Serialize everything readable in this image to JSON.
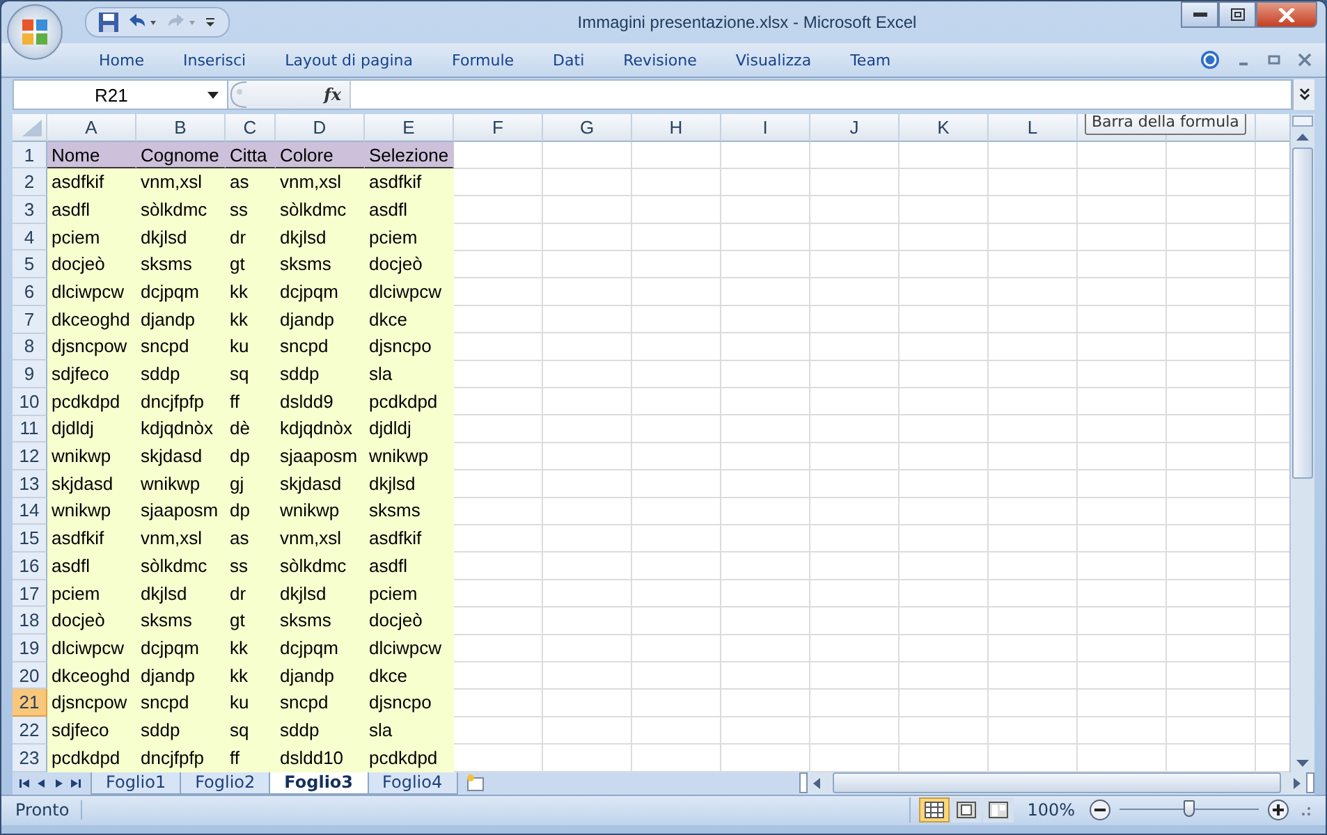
{
  "window": {
    "title": "Immagini presentazione.xlsx - Microsoft Excel"
  },
  "ribbon_tabs": [
    {
      "label": "Home"
    },
    {
      "label": "Inserisci"
    },
    {
      "label": "Layout di pagina"
    },
    {
      "label": "Formule"
    },
    {
      "label": "Dati"
    },
    {
      "label": "Revisione"
    },
    {
      "label": "Visualizza"
    },
    {
      "label": "Team"
    }
  ],
  "name_box": {
    "value": "R21"
  },
  "formula_bar": {
    "fx": "fx",
    "tooltip": "Barra della formula"
  },
  "column_headers": [
    "A",
    "B",
    "C",
    "D",
    "E",
    "F",
    "G",
    "H",
    "I",
    "J",
    "K",
    "L"
  ],
  "rows": [
    {
      "number": "1",
      "kind": "header",
      "selected": false,
      "cells": [
        "Nome",
        "Cognome",
        "Citta",
        "Colore",
        "Selezione"
      ]
    },
    {
      "number": "2",
      "kind": "data",
      "selected": false,
      "cells": [
        "asdfkif",
        "vnm,xsl",
        "as",
        "vnm,xsl",
        "asdfkif"
      ]
    },
    {
      "number": "3",
      "kind": "data",
      "selected": false,
      "cells": [
        "asdfl",
        "sòlkdmc",
        "ss",
        "sòlkdmc",
        "asdfl"
      ]
    },
    {
      "number": "4",
      "kind": "data",
      "selected": false,
      "cells": [
        "pciem",
        "dkjlsd",
        "dr",
        "dkjlsd",
        "pciem"
      ]
    },
    {
      "number": "5",
      "kind": "data",
      "selected": false,
      "cells": [
        "docjeò",
        "sksms",
        "gt",
        "sksms",
        "docjeò"
      ]
    },
    {
      "number": "6",
      "kind": "data",
      "selected": false,
      "cells": [
        "dlciwpcw",
        "dcjpqm",
        "kk",
        "dcjpqm",
        "dlciwpcw"
      ]
    },
    {
      "number": "7",
      "kind": "data",
      "selected": false,
      "cells": [
        "dkceoghd",
        "djandp",
        "kk",
        "djandp",
        "dkce"
      ]
    },
    {
      "number": "8",
      "kind": "data",
      "selected": false,
      "cells": [
        "djsncpow",
        "sncpd",
        "ku",
        "sncpd",
        "djsncpo"
      ]
    },
    {
      "number": "9",
      "kind": "data",
      "selected": false,
      "cells": [
        "sdjfeco",
        "sddp",
        "sq",
        "sddp",
        "sla"
      ]
    },
    {
      "number": "10",
      "kind": "data",
      "selected": false,
      "cells": [
        "pcdkdpd",
        "dncjfpfp",
        "ff",
        "dsldd9",
        "pcdkdpd"
      ]
    },
    {
      "number": "11",
      "kind": "data",
      "selected": false,
      "cells": [
        "djdldj",
        "kdjqdnòx",
        "dè",
        "kdjqdnòx",
        "djdldj"
      ]
    },
    {
      "number": "12",
      "kind": "data",
      "selected": false,
      "cells": [
        "wnikwp",
        "skjdasd",
        "dp",
        "sjaaposm",
        "wnikwp"
      ]
    },
    {
      "number": "13",
      "kind": "data",
      "selected": false,
      "cells": [
        "skjdasd",
        "wnikwp",
        "gj",
        "skjdasd",
        "dkjlsd"
      ]
    },
    {
      "number": "14",
      "kind": "data",
      "selected": false,
      "cells": [
        "wnikwp",
        "sjaaposm",
        "dp",
        "wnikwp",
        "sksms"
      ]
    },
    {
      "number": "15",
      "kind": "data",
      "selected": false,
      "cells": [
        "asdfkif",
        "vnm,xsl",
        "as",
        "vnm,xsl",
        "asdfkif"
      ]
    },
    {
      "number": "16",
      "kind": "data",
      "selected": false,
      "cells": [
        "asdfl",
        "sòlkdmc",
        "ss",
        "sòlkdmc",
        "asdfl"
      ]
    },
    {
      "number": "17",
      "kind": "data",
      "selected": false,
      "cells": [
        "pciem",
        "dkjlsd",
        "dr",
        "dkjlsd",
        "pciem"
      ]
    },
    {
      "number": "18",
      "kind": "data",
      "selected": false,
      "cells": [
        "docjeò",
        "sksms",
        "gt",
        "sksms",
        "docjeò"
      ]
    },
    {
      "number": "19",
      "kind": "data",
      "selected": false,
      "cells": [
        "dlciwpcw",
        "dcjpqm",
        "kk",
        "dcjpqm",
        "dlciwpcw"
      ]
    },
    {
      "number": "20",
      "kind": "data",
      "selected": false,
      "cells": [
        "dkceoghd",
        "djandp",
        "kk",
        "djandp",
        "dkce"
      ]
    },
    {
      "number": "21",
      "kind": "data",
      "selected": true,
      "cells": [
        "djsncpow",
        "sncpd",
        "ku",
        "sncpd",
        "djsncpo"
      ]
    },
    {
      "number": "22",
      "kind": "data",
      "selected": false,
      "cells": [
        "sdjfeco",
        "sddp",
        "sq",
        "sddp",
        "sla"
      ]
    },
    {
      "number": "23",
      "kind": "data",
      "selected": false,
      "cells": [
        "pcdkdpd",
        "dncjfpfp",
        "ff",
        "dsldd10",
        "pcdkdpd"
      ]
    }
  ],
  "sheet_tabs": [
    {
      "label": "Foglio1",
      "selected": false
    },
    {
      "label": "Foglio2",
      "selected": false
    },
    {
      "label": "Foglio3",
      "selected": true
    },
    {
      "label": "Foglio4",
      "selected": false
    }
  ],
  "status_bar": {
    "text": "Pronto",
    "views": [
      {
        "kind": "normal",
        "selected": true
      },
      {
        "kind": "layout",
        "selected": false
      },
      {
        "kind": "pagebreak",
        "selected": false
      }
    ],
    "zoom": {
      "reading": "100%",
      "level": 0.5
    }
  }
}
